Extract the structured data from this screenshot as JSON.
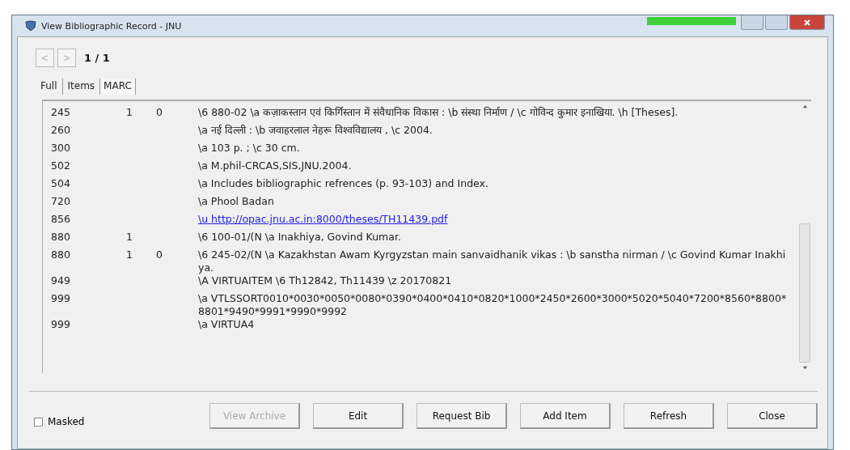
{
  "window": {
    "title": "View Bibliographic Record - JNU"
  },
  "pager": {
    "previous": "<",
    "next": ">",
    "position": "1 / 1"
  },
  "tabs": [
    {
      "label": "Full",
      "selected": false
    },
    {
      "label": "Items",
      "selected": false
    },
    {
      "label": "MARC",
      "selected": true
    }
  ],
  "marc_fields": [
    {
      "tag": "245",
      "ind1": "1",
      "ind2": "0",
      "kind": "text",
      "data": "\\6 880-02 \\a कज़ाकस्तान एवं किर्गिस्तान में संवैधानिक विकास : \\b संस्था निर्माण / \\c गोविन्द कुमार इनाखिया. \\h [Theses]."
    },
    {
      "tag": "260",
      "kind": "text",
      "data": "\\a नई दिल्ली : \\b जवाहरलाल नेहरू विश्वविद्यालय , \\c 2004."
    },
    {
      "tag": "300",
      "kind": "text",
      "data": "\\a 103 p. ; \\c 30 cm."
    },
    {
      "tag": "502",
      "kind": "text",
      "data": "\\a M.phil-CRCAS,SIS,JNU.2004."
    },
    {
      "tag": "504",
      "kind": "text",
      "data": "\\a Includes bibliographic refrences (p. 93-103) and Index."
    },
    {
      "tag": "720",
      "kind": "text",
      "data": "\\a Phool Badan"
    },
    {
      "tag": "856",
      "kind": "link",
      "data": "\\u http://opac.jnu.ac.in:8000/theses/TH11439.pdf"
    },
    {
      "tag": "880",
      "ind1": "1",
      "kind": "text",
      "data": "\\6 100-01/(N \\a Inakhiya, Govind Kumar."
    },
    {
      "tag": "880",
      "ind1": "1",
      "ind2": "0",
      "kind": "text",
      "data": "\\6 245-02/(N \\a Kazakhstan Awam Kyrgyzstan main sanvaidhanik vikas : \\b sanstha nirman / \\c Govind Kumar Inakhiya."
    },
    {
      "tag": "949",
      "kind": "text",
      "data": "\\A VIRTUAITEM \\6 Th12842, Th11439 \\z 20170821"
    },
    {
      "tag": "999",
      "kind": "text",
      "data": "\\a VTLSSORT0010*0030*0050*0080*0390*0400*0410*0820*1000*2450*2600*3000*5020*5040*7200*8560*8800*8801*9490*9991*9990*9992"
    },
    {
      "tag": "999",
      "kind": "text",
      "data": "\\a VIRTUA4"
    }
  ],
  "masked": {
    "label": "Masked",
    "checked": false
  },
  "buttons": [
    {
      "label": "View Archive",
      "disabled": true
    },
    {
      "label": "Edit",
      "disabled": false
    },
    {
      "label": "Request Bib",
      "disabled": false
    },
    {
      "label": "Add Item",
      "disabled": false
    },
    {
      "label": "Refresh",
      "disabled": false
    },
    {
      "label": "Close",
      "disabled": false
    }
  ]
}
